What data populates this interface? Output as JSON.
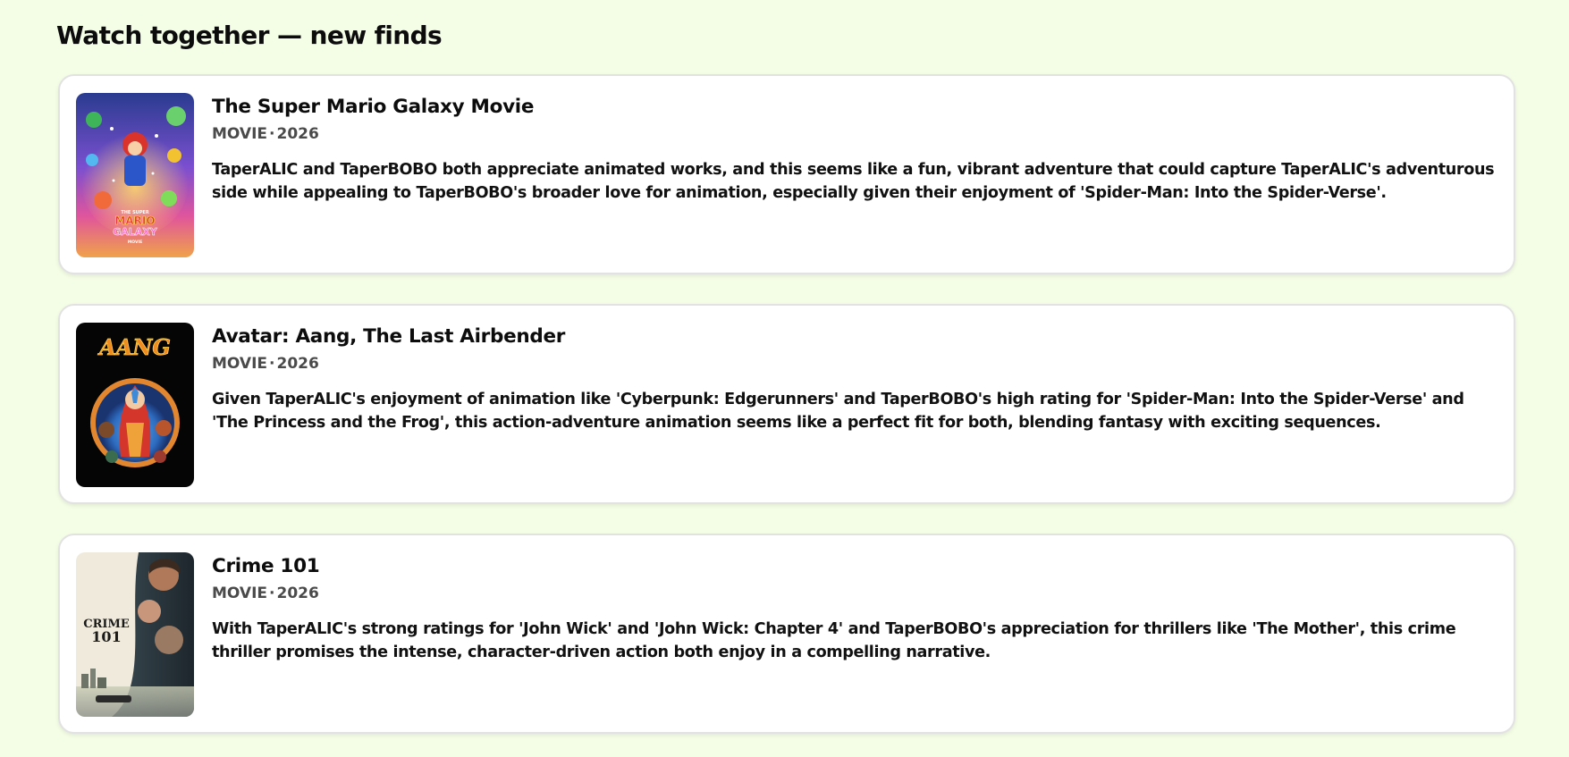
{
  "page": {
    "heading": "Watch together — new finds"
  },
  "colors": {
    "background": "#f4fde6",
    "card": "#ffffff",
    "card_border": "#e2e2e2",
    "meta_text": "#4a4a4a"
  },
  "items": [
    {
      "title": "The Super Mario Galaxy Movie",
      "type": "MOVIE",
      "separator": "·",
      "year": "2026",
      "description": "TaperALIC and TaperBOBO both appreciate animated works, and this seems like a fun, vibrant adventure that could capture TaperALIC's adventurous side while appealing to TaperBOBO's broader love for animation, especially given their enjoyment of 'Spider-Man: Into the Spider-Verse'.",
      "poster": {
        "icon": "mario-galaxy-poster-image",
        "label_lines": [
          "THE SUPER",
          "MARIO",
          "GALAXY",
          "MOVIE"
        ]
      }
    },
    {
      "title": "Avatar: Aang, The Last Airbender",
      "type": "MOVIE",
      "separator": "·",
      "year": "2026",
      "description": "Given TaperALIC's enjoyment of animation like 'Cyberpunk: Edgerunners' and TaperBOBO's high rating for 'Spider-Man: Into the Spider-Verse' and 'The Princess and the Frog', this action-adventure animation seems like a perfect fit for both, blending fantasy with exciting sequences.",
      "poster": {
        "icon": "avatar-aang-poster-image",
        "label_lines": [
          "AANG"
        ]
      }
    },
    {
      "title": "Crime 101",
      "type": "MOVIE",
      "separator": "·",
      "year": "2026",
      "description": "With TaperALIC's strong ratings for 'John Wick' and 'John Wick: Chapter 4' and TaperBOBO's appreciation for thrillers like 'The Mother', this crime thriller promises the intense, character-driven action both enjoy in a compelling narrative.",
      "poster": {
        "icon": "crime-101-poster-image",
        "label_lines": [
          "CRIME",
          "101"
        ]
      }
    }
  ]
}
